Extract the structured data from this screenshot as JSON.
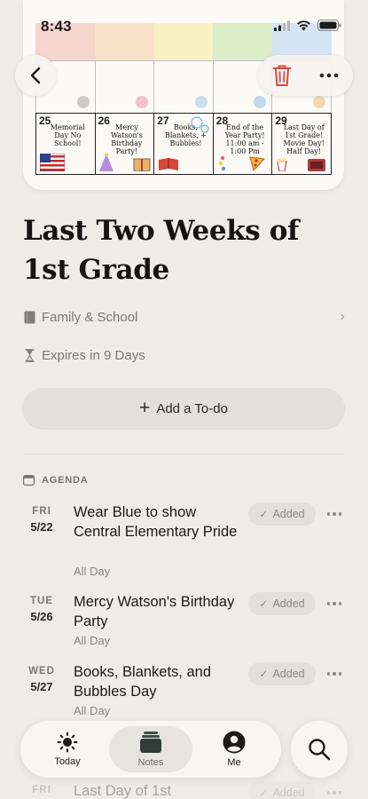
{
  "status_bar": {
    "time": "8:43"
  },
  "hero": {
    "calendar_days": [
      {
        "num": "25",
        "text": "Memorial Day No School!",
        "sticker": "flag"
      },
      {
        "num": "26",
        "text": "Mercy Watson's Birthday Party!",
        "sticker": "party"
      },
      {
        "num": "27",
        "text": "Books, Blankets, + Bubbles!",
        "sticker": "books"
      },
      {
        "num": "28",
        "text": "End of the Year Party! 11:00 am - 1:00 Pm",
        "sticker": "pizza"
      },
      {
        "num": "29",
        "text": "Last Day of 1st Grade! Movie Day! Half Day!",
        "sticker": "popcorn"
      }
    ]
  },
  "note": {
    "title": "Last Two Weeks of 1st Grade",
    "category": "Family & School",
    "expires": "Expires in 9 Days",
    "add_todo_label": "Add a To-do"
  },
  "agenda": {
    "label": "AGENDA",
    "events": [
      {
        "dow": "FRI",
        "date": "5/22",
        "title": "Wear Blue to show Central Elementary Pride",
        "sub": "All Day",
        "badge": "Added"
      },
      {
        "dow": "TUE",
        "date": "5/26",
        "title": "Mercy Watson's Birthday Party",
        "sub": "All Day",
        "badge": "Added"
      },
      {
        "dow": "WED",
        "date": "5/27",
        "title": "Books, Blankets, and Bubbles Day",
        "sub": "All Day",
        "badge": "Added"
      },
      {
        "dow": "FRI",
        "date": "",
        "title": "Last Day of 1st",
        "sub": "",
        "badge": "Added"
      }
    ]
  },
  "tabbar": {
    "tabs": [
      {
        "label": "Today",
        "icon": "sun-icon"
      },
      {
        "label": "Notes",
        "icon": "notes-icon"
      },
      {
        "label": "Me",
        "icon": "person-icon"
      }
    ]
  },
  "colors": {
    "background": "#efece8",
    "delete": "#d8463c",
    "pill": "#e3e0db"
  }
}
